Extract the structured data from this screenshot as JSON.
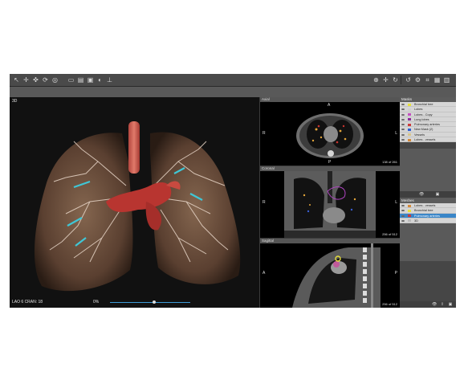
{
  "toolbar": {
    "left_tools": [
      "arrow-icon",
      "pan-icon",
      "move-icon",
      "rotate-icon",
      "target-icon",
      "layout-icon",
      "window-icon",
      "image-icon",
      "palette-icon",
      "measure-icon"
    ],
    "right_tools": [
      "zoom-in-icon",
      "crosshair-icon",
      "refresh-icon",
      "reset-icon",
      "settings-icon",
      "crop-icon",
      "screenshot-icon",
      "grid-icon"
    ]
  },
  "view3d": {
    "label": "3D",
    "orientation": "LAO 6    CRAN: 18",
    "slider_label": "0%",
    "slider_level": 0.55
  },
  "axial": {
    "title": "Axial",
    "top": "A",
    "left": "R",
    "right": "L",
    "bottom": "P",
    "slice": "138 of 261"
  },
  "coronal": {
    "title": "Coronal",
    "left": "R",
    "right": "L",
    "slice": "256 of 512"
  },
  "sagittal": {
    "title": "Sagittal",
    "left": "A",
    "right": "P",
    "slice": "256 of 512"
  },
  "masks": {
    "title": "Masks",
    "items": [
      {
        "label": "Bronchial tree",
        "color": "#e9e23a"
      },
      {
        "label": "Lobes",
        "color": "#cfcfcf"
      },
      {
        "label": "Lobes - Copy",
        "color": "#c44fc0"
      },
      {
        "label": "Lung lobes",
        "color": "#8b2c9b"
      },
      {
        "label": "Pulmonary arteries",
        "color": "#cc3a3a"
      },
      {
        "label": "New Mask (2)",
        "color": "#2f5fd4"
      },
      {
        "label": "Vessels",
        "color": "#d8c58c"
      },
      {
        "label": "Lobes - vessels",
        "color": "#d48a3a"
      }
    ]
  },
  "meshes": {
    "title": "Meshes",
    "items": [
      {
        "label": "Lobes - vessels",
        "color": "#d48a3a",
        "selected": false
      },
      {
        "label": "Bronchial tree",
        "color": "#e9e23a",
        "selected": false
      },
      {
        "label": "Pulmonary arteries",
        "color": "#cc3a3a",
        "selected": true
      },
      {
        "label": "3D",
        "color": "#bbbbbb",
        "selected": false
      }
    ]
  }
}
